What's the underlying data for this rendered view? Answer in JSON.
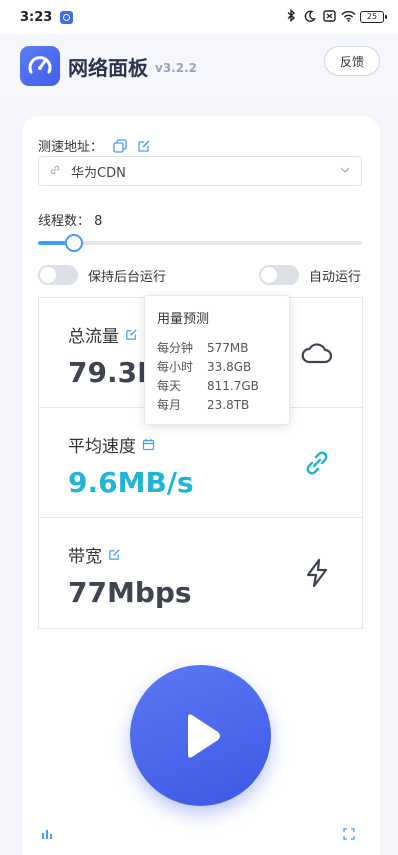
{
  "status_bar": {
    "time": "3:23",
    "battery": "25",
    "icons": [
      "bluetooth-icon",
      "moon-icon",
      "sim-off-icon",
      "wifi-icon",
      "battery-icon"
    ]
  },
  "header": {
    "title": "网络面板",
    "version": "v3.2.2",
    "feedback_label": "反馈"
  },
  "settings": {
    "speed_url_label": "测速地址：",
    "selected_server": "华为CDN",
    "threads_label": "线程数：",
    "threads_value": "8",
    "threads_fraction": 0.11,
    "keep_bg_label": "保持后台运行",
    "keep_bg_on": false,
    "auto_run_label": "自动运行",
    "auto_run_on": false
  },
  "stats": {
    "total_title": "总流量",
    "total_value": "79.3M",
    "avg_title": "平均速度",
    "avg_value": "9.6MB/s",
    "bandwidth_title": "带宽",
    "bandwidth_value": "77Mbps"
  },
  "tooltip": {
    "title": "用量预测",
    "rows": [
      {
        "k": "每分钟",
        "v": "577MB"
      },
      {
        "k": "每小时",
        "v": "33.8GB"
      },
      {
        "k": "每天",
        "v": "811.7GB"
      },
      {
        "k": "每月",
        "v": "23.8TB"
      }
    ]
  },
  "colors": {
    "accent": "#409eff",
    "speed": "#1fb6d6",
    "brand": "#4a68ee"
  }
}
